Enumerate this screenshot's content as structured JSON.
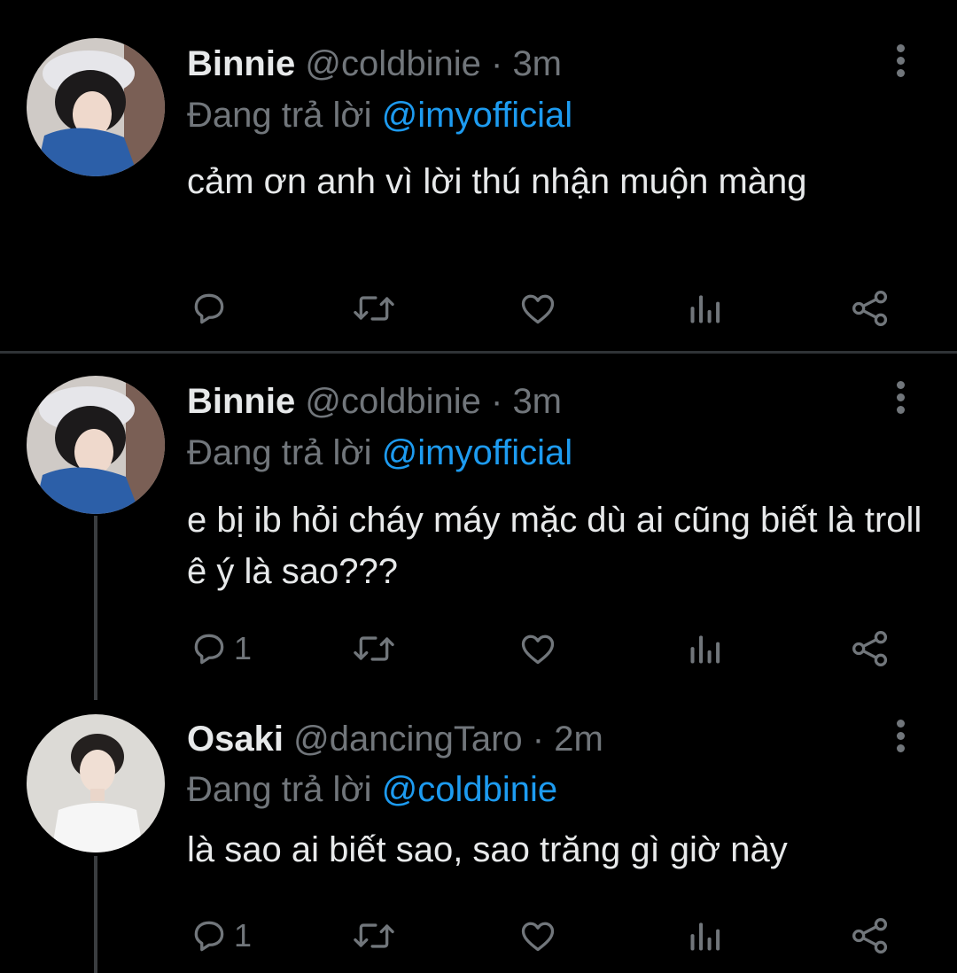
{
  "colors": {
    "background": "#000000",
    "primary_text": "#e7e9ea",
    "secondary_text": "#71767b",
    "accent": "#1d9bf0",
    "divider": "#2f3336"
  },
  "tweets": [
    {
      "name": "Binnie",
      "handle": "@coldbinie",
      "separator": "·",
      "time": "3m",
      "replying_prefix": "Đang trả lời",
      "replying_to": "@imyofficial",
      "text": "cảm ơn anh vì lời thú nhận muộn màng",
      "reply_count": "",
      "icons": [
        "reply-icon",
        "retweet-icon",
        "like-icon",
        "views-icon",
        "share-icon",
        "more-icon"
      ]
    },
    {
      "name": "Binnie",
      "handle": "@coldbinie",
      "separator": "·",
      "time": "3m",
      "replying_prefix": "Đang trả lời",
      "replying_to": "@imyofficial",
      "text": "e bị ib hỏi cháy máy mặc dù ai cũng biết là troll ê ý là sao???",
      "reply_count": "1",
      "icons": [
        "reply-icon",
        "retweet-icon",
        "like-icon",
        "views-icon",
        "share-icon",
        "more-icon"
      ]
    },
    {
      "name": "Osaki",
      "handle": "@dancingTaro",
      "separator": "·",
      "time": "2m",
      "replying_prefix": "Đang trả lời",
      "replying_to": "@coldbinie",
      "text": "là sao ai biết sao, sao trăng gì giờ này",
      "reply_count": "1",
      "icons": [
        "reply-icon",
        "retweet-icon",
        "like-icon",
        "views-icon",
        "share-icon",
        "more-icon"
      ]
    }
  ]
}
